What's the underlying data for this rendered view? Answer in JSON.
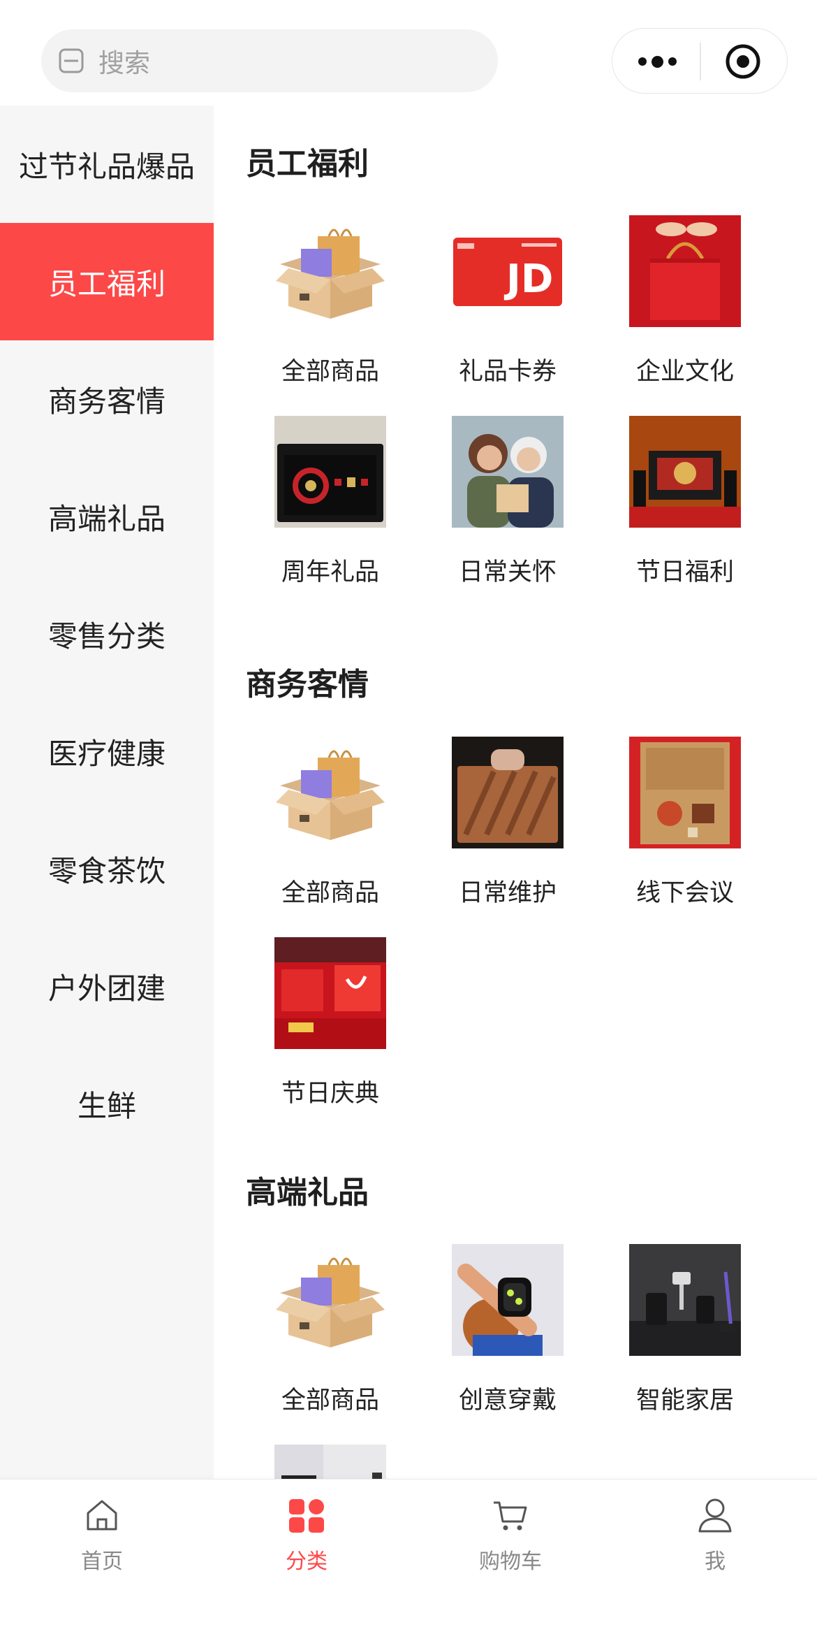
{
  "search": {
    "placeholder": "搜索"
  },
  "capsule": {
    "more_icon": "more-dots-icon",
    "close_icon": "target-circle-icon"
  },
  "sidebar": {
    "active_index": 1,
    "items": [
      "过节礼品爆品",
      "员工福利",
      "商务客情",
      "高端礼品",
      "零售分类",
      "医疗健康",
      "零食茶饮",
      "户外团建",
      "生鲜"
    ]
  },
  "sections": [
    {
      "title": "员工福利",
      "items": [
        "全部商品",
        "礼品卡券",
        "企业文化",
        "周年礼品",
        "日常关怀",
        "节日福利"
      ]
    },
    {
      "title": "商务客情",
      "items": [
        "全部商品",
        "日常维护",
        "线下会议",
        "节日庆典"
      ]
    },
    {
      "title": "高端礼品",
      "items": [
        "全部商品",
        "创意穿戴",
        "智能家居"
      ]
    }
  ],
  "gift_card": {
    "brand_text": "JD"
  },
  "tabs": [
    {
      "label": "首页",
      "icon": "home-icon"
    },
    {
      "label": "分类",
      "icon": "category-icon"
    },
    {
      "label": "购物车",
      "icon": "cart-icon"
    },
    {
      "label": "我",
      "icon": "user-icon"
    }
  ],
  "colors": {
    "accent": "#fd4848",
    "sidebar_bg": "#f6f6f6",
    "search_bg": "#f3f3f3"
  }
}
